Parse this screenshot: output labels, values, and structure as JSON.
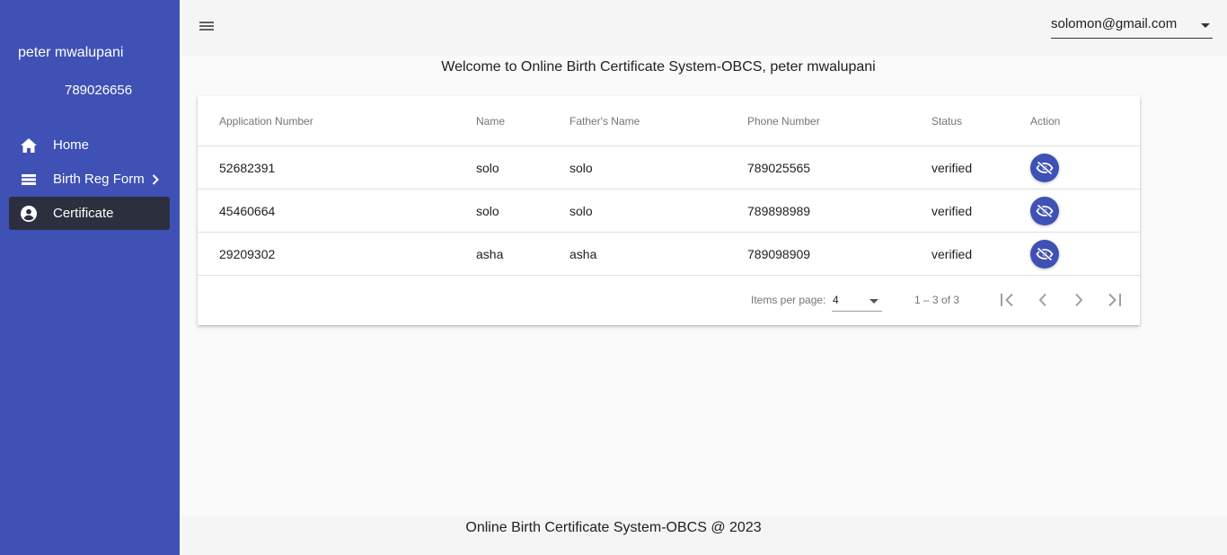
{
  "sidebar": {
    "user_name": "peter mwalupani",
    "user_phone": "789026656",
    "items": [
      {
        "label": "Home",
        "icon": "home-icon"
      },
      {
        "label": "Birth Reg Form",
        "icon": "list-icon"
      },
      {
        "label": "Certificate",
        "icon": "account-circle-icon"
      }
    ],
    "active_index": 2
  },
  "header": {
    "menu_icon": "menu-icon",
    "account": "solomon@gmail.com"
  },
  "welcome": "Welcome to Online Birth Certificate System-OBCS, peter mwalupani",
  "table": {
    "columns": [
      "Application Number",
      "Name",
      "Father's Name",
      "Phone Number",
      "Status",
      "Action"
    ],
    "rows": [
      {
        "app": "52682391",
        "name": "solo",
        "father": "solo",
        "phone": "789025565",
        "status": "verified"
      },
      {
        "app": "45460664",
        "name": "solo",
        "father": "solo",
        "phone": "789898989",
        "status": "verified"
      },
      {
        "app": "29209302",
        "name": "asha",
        "father": "asha",
        "phone": "789098909",
        "status": "verified"
      }
    ],
    "action_icon": "visibility-off-icon"
  },
  "paginator": {
    "items_per_page_label": "Items per page:",
    "items_per_page": "4",
    "range": "1 – 3 of 3"
  },
  "footer": "Online Birth Certificate System-OBCS @ 2023",
  "colors": {
    "primary": "#3f51b5",
    "active_nav": "#2b2f3e",
    "background": "#fafafa"
  }
}
